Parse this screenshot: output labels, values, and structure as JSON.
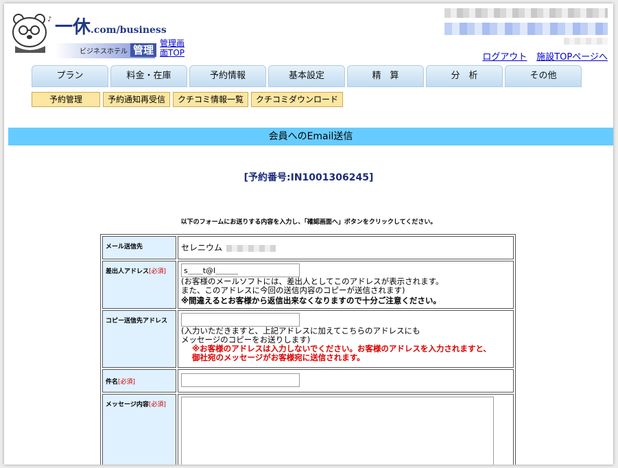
{
  "header": {
    "logo_main": "一休",
    "logo_dot_com": ".com/business",
    "logo_hotel": "ビジネスホテル",
    "logo_kanri": "管理",
    "admin_top_link": "管理画面TOP",
    "logout": "ログアウト",
    "facility_top": "施設TOPページへ"
  },
  "main_nav": [
    "プラン",
    "料金・在庫",
    "予約情報",
    "基本設定",
    "精　算",
    "分　析",
    "その他"
  ],
  "sub_nav": [
    "予約管理",
    "予約通知再受信",
    "クチコミ情報一覧",
    "クチコミダウンロード"
  ],
  "page": {
    "title": "会員へのEmail送信",
    "reservation_number": "[予約番号:IN1001306245]",
    "instruction": "以下のフォームにお送りする内容を入力し、「確認画面へ」ボタンをクリックしてください。"
  },
  "form": {
    "required_mark": "[必須]",
    "recipient": {
      "label": "メール送信先",
      "value": "セレニウム"
    },
    "sender": {
      "label": "差出人アドレス",
      "value": "s＿＿t@l＿＿＿",
      "note1": "(お客様のメールソフトには、差出人としてこのアドレスが表示されます。",
      "note2": "また、このアドレスに今回の送信内容のコピーが送信されます)",
      "note_bold": "※間違えるとお客様から返信出来なくなりますので十分ご注意ください。"
    },
    "copy": {
      "label": "コピー送信先アドレス",
      "value": "",
      "note1": "(入力いただきますと、上記アドレスに加えてこちらのアドレスにも",
      "note2": "メッセージのコピーをお送りします)",
      "warn1": "※お客様のアドレスは入力しないでください。お客様のアドレスを入力されますと、",
      "warn2": "御社宛のメッセージがお客様宛に送信されます。"
    },
    "subject": {
      "label": "件名",
      "value": ""
    },
    "message": {
      "label": "メッセージ内容",
      "value": ""
    }
  }
}
